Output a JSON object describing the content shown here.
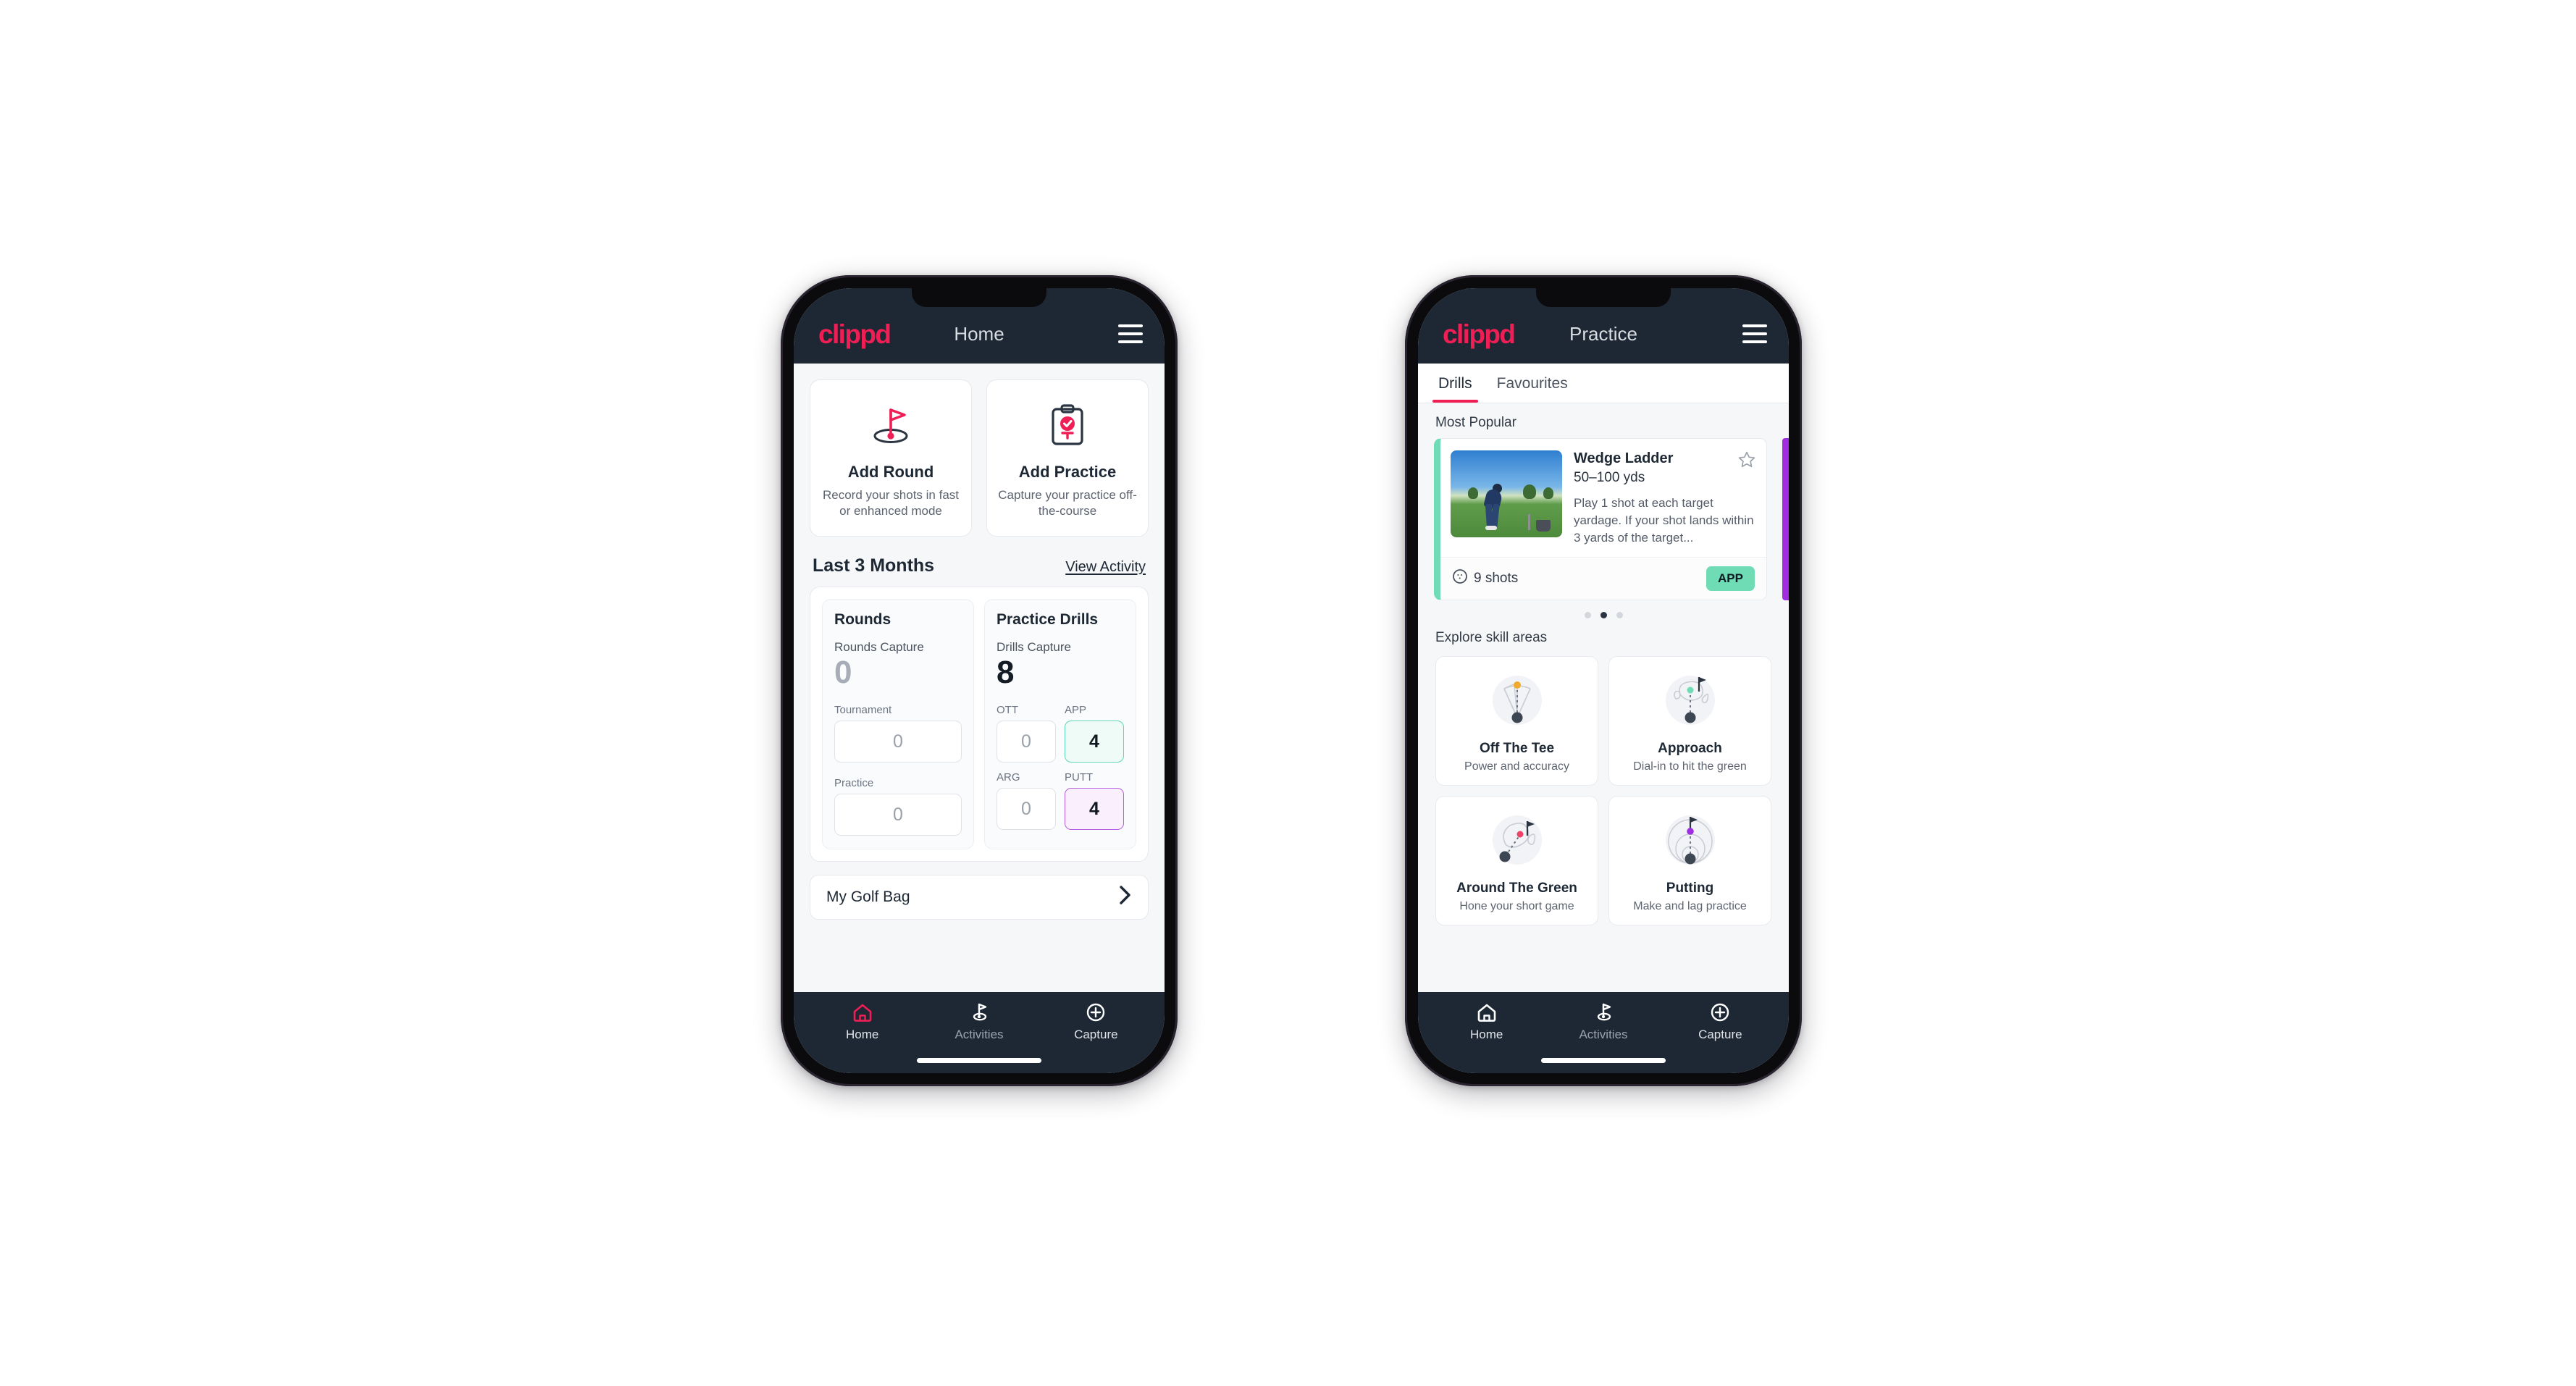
{
  "colors": {
    "brand_pink": "#ef1f56",
    "appbar_dark": "#1d2834",
    "accent_green": "#6fdcb6",
    "accent_purple": "#a02de0",
    "putt_purple": "#b65fdd",
    "page_bg": "#f6f7f9"
  },
  "phone_home": {
    "appbar": {
      "logo": "clippd",
      "title": "Home",
      "menu_icon": "hamburger-menu-icon"
    },
    "actions": [
      {
        "icon": "golf-flag-hole-icon",
        "title": "Add Round",
        "subtitle": "Record your shots in fast or enhanced mode"
      },
      {
        "icon": "clipboard-check-icon",
        "title": "Add Practice",
        "subtitle": "Capture your practice off-the-course"
      }
    ],
    "section": {
      "title": "Last 3 Months",
      "link": "View Activity"
    },
    "rounds": {
      "heading": "Rounds",
      "capture_label": "Rounds Capture",
      "capture_value": "0",
      "tiles": [
        {
          "caption": "Tournament",
          "value": "0",
          "style": "muted"
        },
        {
          "caption": "Practice",
          "value": "0",
          "style": "muted"
        }
      ]
    },
    "drills": {
      "heading": "Practice Drills",
      "capture_label": "Drills Capture",
      "capture_value": "8",
      "tiles": [
        {
          "caption": "OTT",
          "value": "0",
          "style": "muted"
        },
        {
          "caption": "APP",
          "value": "4",
          "style": "app"
        },
        {
          "caption": "ARG",
          "value": "0",
          "style": "muted"
        },
        {
          "caption": "PUTT",
          "value": "4",
          "style": "putt"
        }
      ]
    },
    "golf_bag": {
      "label": "My Golf Bag",
      "chevron_icon": "chevron-right-icon"
    },
    "nav": [
      {
        "icon": "home-icon",
        "label": "Home",
        "active": true
      },
      {
        "icon": "golf-flag-icon",
        "label": "Activities",
        "active": false
      },
      {
        "icon": "plus-circle-icon",
        "label": "Capture",
        "active": false
      }
    ]
  },
  "phone_practice": {
    "appbar": {
      "logo": "clippd",
      "title": "Practice",
      "menu_icon": "hamburger-menu-icon"
    },
    "tabs": [
      {
        "label": "Drills",
        "active": true
      },
      {
        "label": "Favourites",
        "active": false
      }
    ],
    "most_popular": {
      "caption": "Most Popular",
      "drill": {
        "title": "Wedge Ladder",
        "yardage": "50–100 yds",
        "description": "Play 1 shot at each target yardage. If your shot lands within 3 yards of the target...",
        "shots": "9 shots",
        "shots_icon": "golf-ball-icon",
        "badge": "APP",
        "star_icon": "star-outline-icon",
        "thumbnail": "golfer-driving-range-photo",
        "accent": "#6fdcb6"
      },
      "dots": [
        false,
        true,
        false
      ]
    },
    "skills": {
      "caption": "Explore skill areas",
      "cards": [
        {
          "icon": "tee-shot-fan-icon",
          "name": "Off The Tee",
          "sub": "Power and accuracy"
        },
        {
          "icon": "green-approach-icon",
          "name": "Approach",
          "sub": "Dial-in to hit the green"
        },
        {
          "icon": "chip-around-green-icon",
          "name": "Around The Green",
          "sub": "Hone your short game"
        },
        {
          "icon": "putting-rings-icon",
          "name": "Putting",
          "sub": "Make and lag practice"
        }
      ]
    },
    "nav": [
      {
        "icon": "home-icon",
        "label": "Home",
        "active": false
      },
      {
        "icon": "golf-flag-icon",
        "label": "Activities",
        "active": false
      },
      {
        "icon": "plus-circle-icon",
        "label": "Capture",
        "active": false
      }
    ]
  }
}
